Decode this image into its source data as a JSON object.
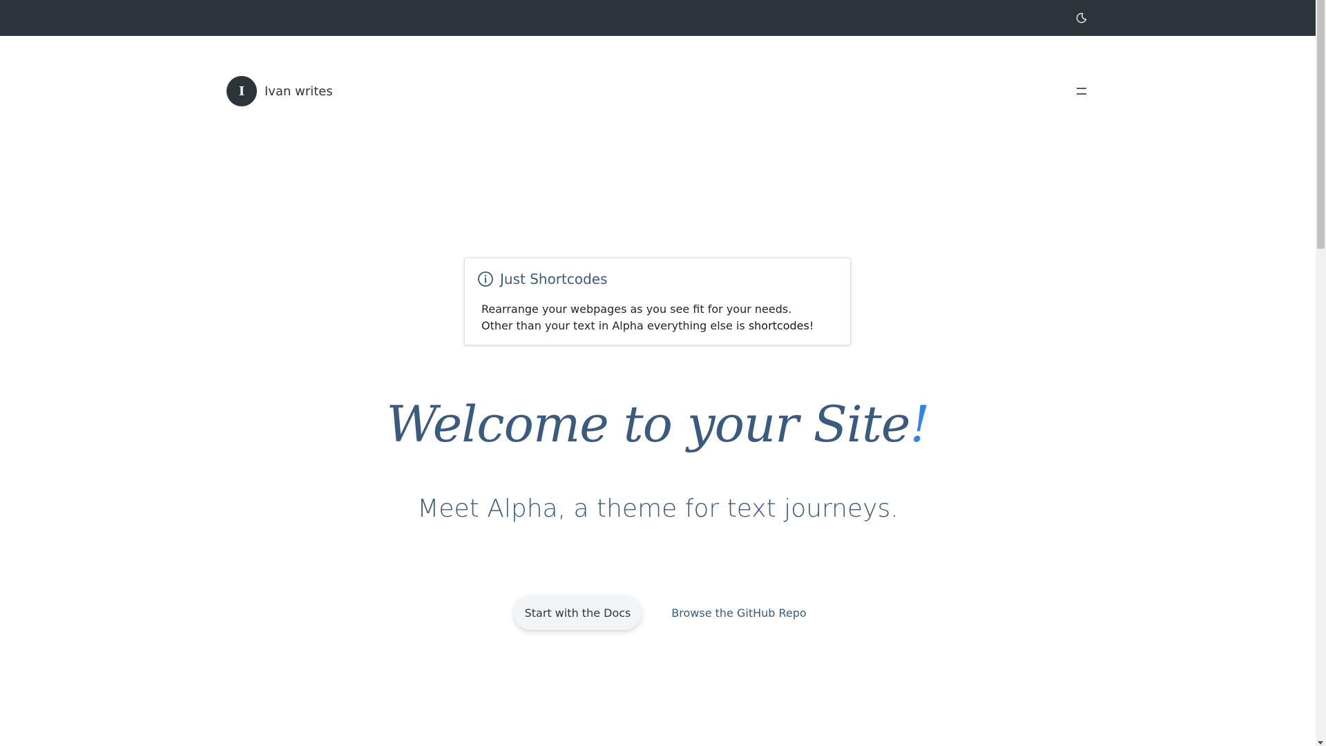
{
  "header": {
    "avatar_letter": "I",
    "site_name": "Ivan writes"
  },
  "topbar": {
    "theme_icon": "moon-icon"
  },
  "nav": {
    "menu_icon": "menu-icon"
  },
  "callout": {
    "icon": "info-icon",
    "title": "Just Shortcodes",
    "line1": "Rearrange your webpages as you see fit for your needs.",
    "line2_prefix": "Other than your text in Alpha everything else is ",
    "line2_strong": "shortcodes",
    "line2_suffix": "!"
  },
  "hero": {
    "title_main": "Welcome to your Site",
    "title_accent": "!",
    "subtitle": "Meet Alpha, a theme for text journeys."
  },
  "cta": {
    "primary_label": "Start with the Docs",
    "secondary_label": "Browse the GitHub Repo"
  },
  "colors": {
    "topbar_bg": "#2c3539",
    "heading": "#3a5a80",
    "accent": "#2f86e6"
  }
}
